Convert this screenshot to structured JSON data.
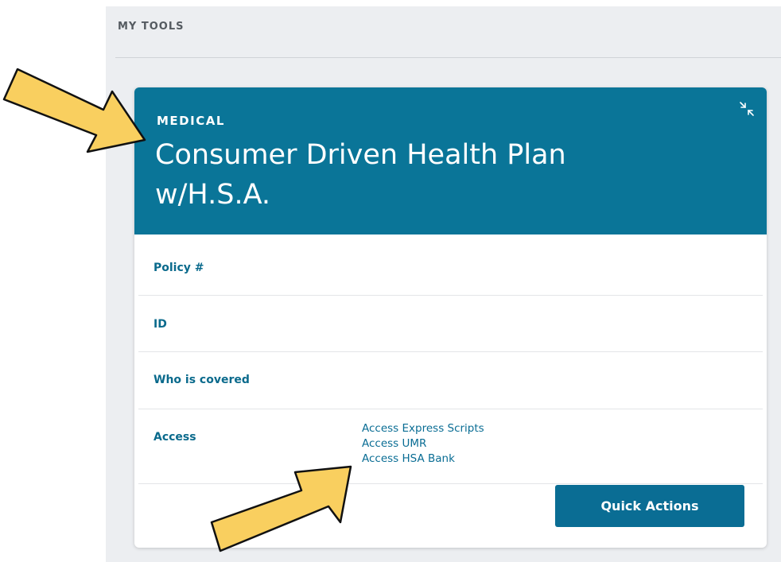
{
  "section": {
    "title": "MY TOOLS"
  },
  "card": {
    "category": "MEDICAL",
    "plan_name_line1": "Consumer Driven Health Plan",
    "plan_name_line2": "w/H.S.A.",
    "collapse_icon": "collapse-arrows-icon",
    "rows": [
      {
        "label": "Policy #"
      },
      {
        "label": "ID"
      },
      {
        "label": "Who is covered"
      },
      {
        "label": "Access"
      }
    ],
    "access_links": [
      "Access Express Scripts",
      "Access UMR",
      "Access HSA Bank"
    ],
    "quick_actions_label": "Quick Actions"
  },
  "colors": {
    "header_bg": "#0a7598",
    "link": "#0a6d94",
    "arrow_fill": "#f9cf5f",
    "arrow_stroke": "#111111"
  },
  "annotations": [
    "arrow-pointing-to-plan-name",
    "arrow-pointing-to-access-links"
  ]
}
